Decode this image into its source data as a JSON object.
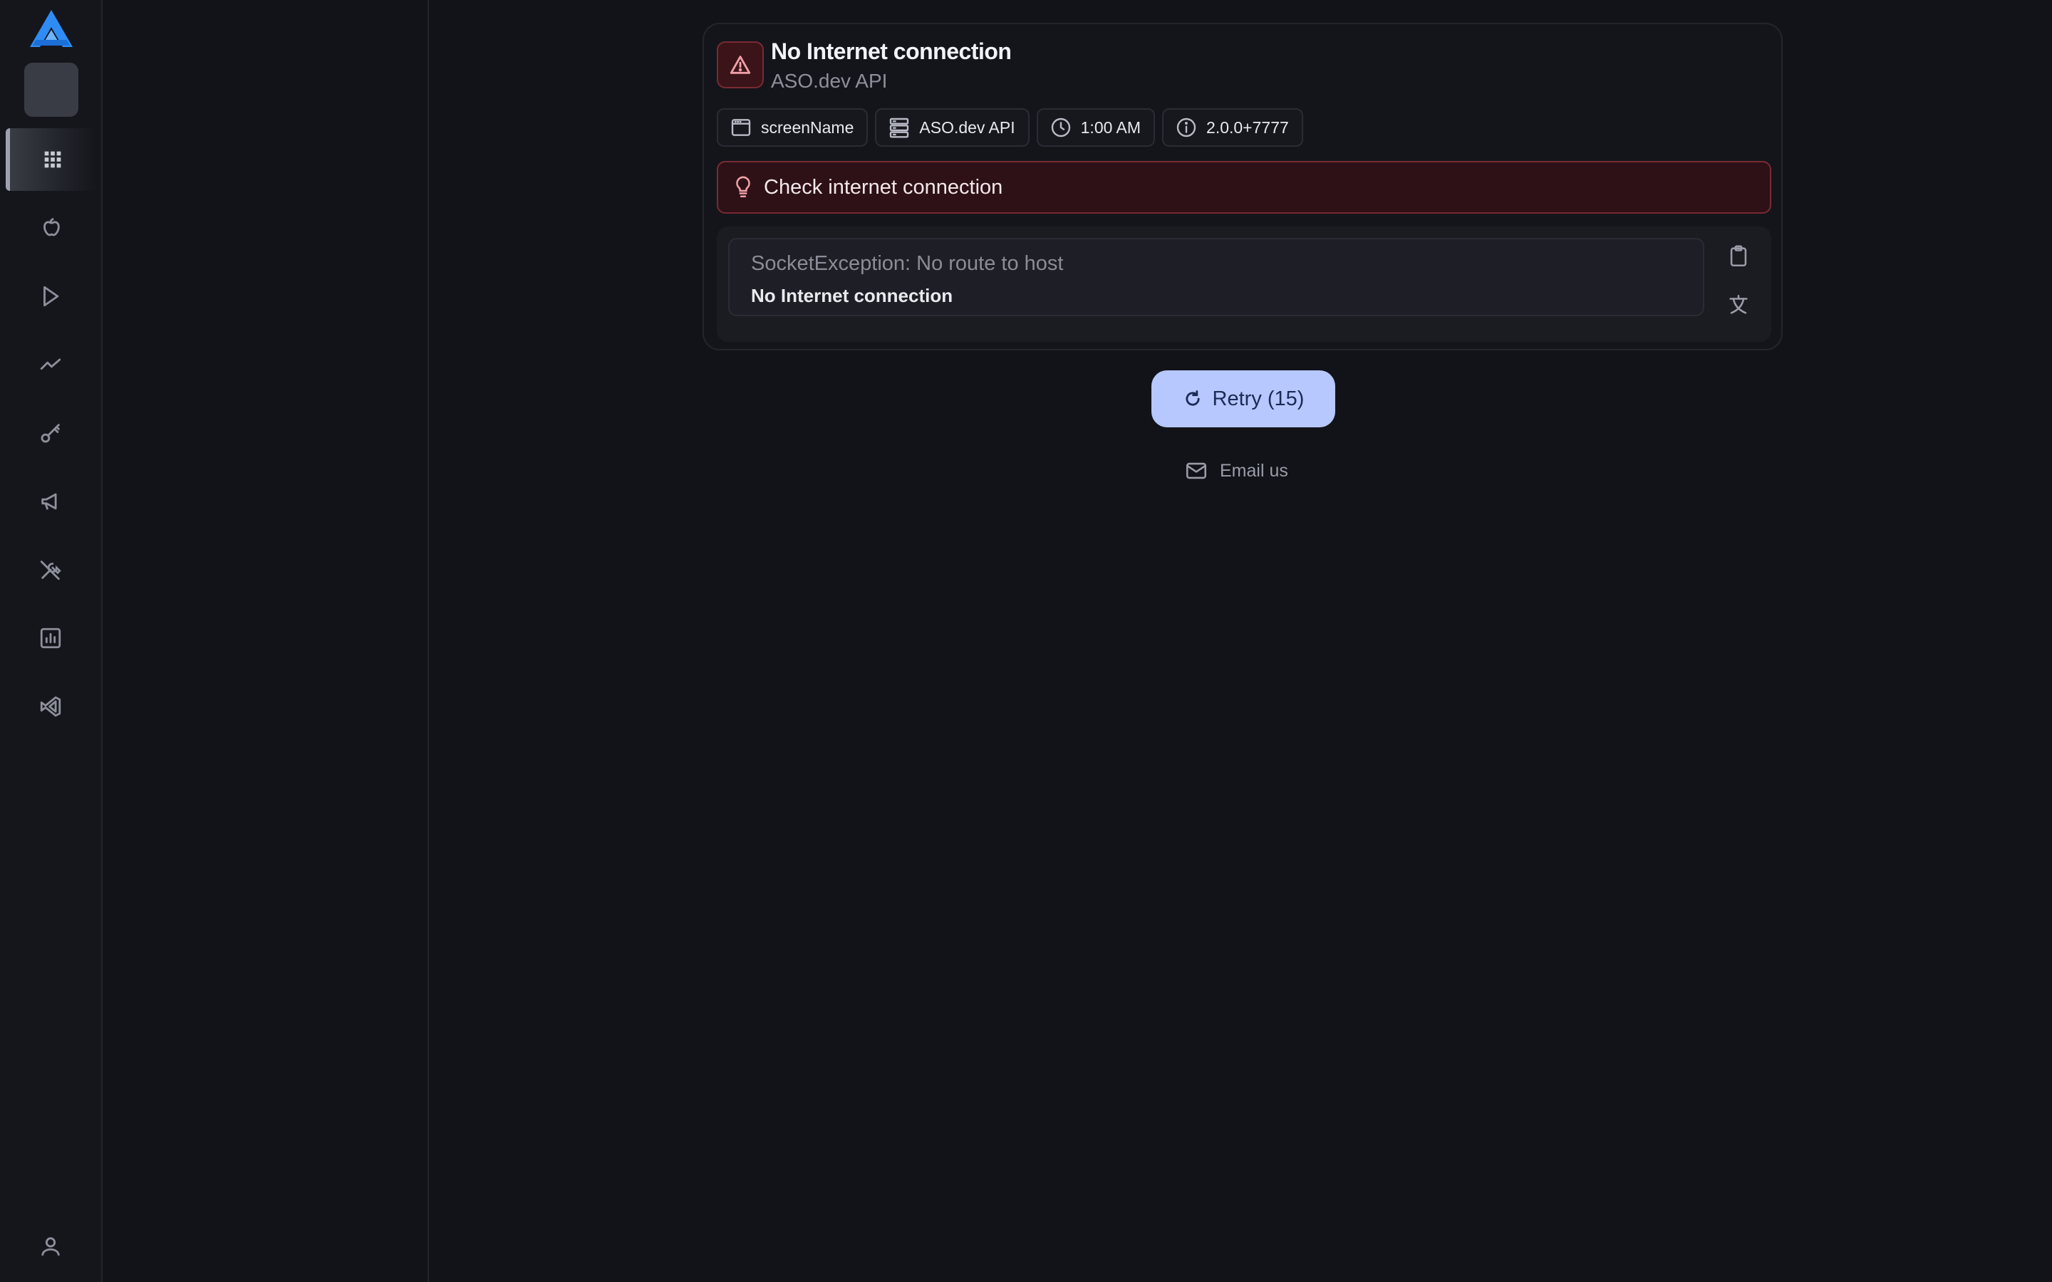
{
  "sidebar": {
    "items": [
      {
        "name": "dashboard",
        "icon": "grid-icon",
        "active": true
      },
      {
        "name": "app-store",
        "icon": "apple-icon"
      },
      {
        "name": "google-play",
        "icon": "play-icon"
      },
      {
        "name": "trends",
        "icon": "trend-icon"
      },
      {
        "name": "keywords",
        "icon": "key-icon"
      },
      {
        "name": "marketing",
        "icon": "megaphone-icon"
      },
      {
        "name": "tools",
        "icon": "tools-icon"
      },
      {
        "name": "reports",
        "icon": "chart-icon"
      },
      {
        "name": "vscode",
        "icon": "vscode-icon"
      }
    ],
    "account_icon": "user-icon"
  },
  "error_card": {
    "title": "No Internet connection",
    "subtitle": "ASO.dev API",
    "chips": [
      {
        "icon": "window-icon",
        "label": "screenName"
      },
      {
        "icon": "server-icon",
        "label": "ASO.dev API"
      },
      {
        "icon": "clock-icon",
        "label": "1:00 AM"
      },
      {
        "icon": "info-icon",
        "label": "2.0.0+7777"
      }
    ],
    "hint": "Check internet connection",
    "exception_type": "SocketException: No route to host",
    "exception_message": "No Internet connection"
  },
  "actions": {
    "retry_label": "Retry (15)",
    "email_label": "Email us"
  },
  "colors": {
    "background": "#121319",
    "accent_retry": "#b6c8ff",
    "error_border": "#7a2a33",
    "error_fill": "#2d1117",
    "logo_blue": "#2f8cf5"
  }
}
